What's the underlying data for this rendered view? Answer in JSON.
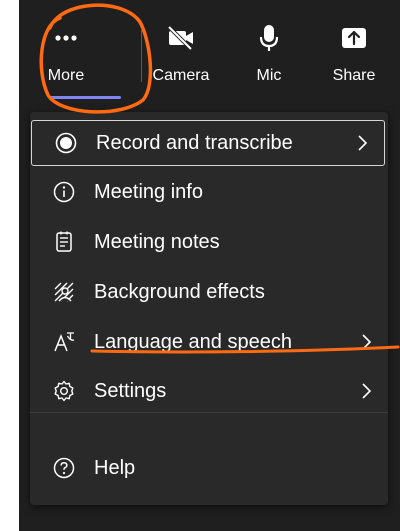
{
  "toolbar": {
    "more_label": "More",
    "camera_label": "Camera",
    "mic_label": "Mic",
    "share_label": "Share",
    "active_indicator_color": "#7f85f5"
  },
  "menu": {
    "items": [
      {
        "label": "Record and transcribe",
        "icon": "record-icon",
        "has_submenu": true
      },
      {
        "label": "Meeting info",
        "icon": "info-icon",
        "has_submenu": false
      },
      {
        "label": "Meeting notes",
        "icon": "notes-icon",
        "has_submenu": false
      },
      {
        "label": "Background effects",
        "icon": "background-effects-icon",
        "has_submenu": false
      },
      {
        "label": "Language and speech",
        "icon": "language-icon",
        "has_submenu": true
      },
      {
        "label": "Settings",
        "icon": "gear-icon",
        "has_submenu": true
      },
      {
        "label": "Help",
        "icon": "help-icon",
        "has_submenu": false
      }
    ]
  },
  "annotation_color": "#ff6a13"
}
